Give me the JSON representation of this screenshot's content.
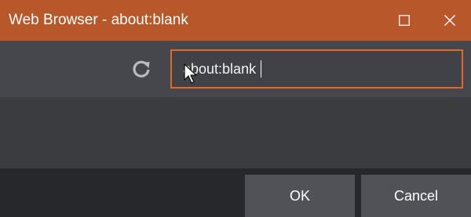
{
  "window": {
    "title": "Web Browser - about:blank",
    "accent_color": "#b8572a",
    "focus_color": "#e0692a"
  },
  "titlebar_buttons": {
    "maximize_icon": "maximize-icon",
    "close_icon": "close-icon"
  },
  "toolbar": {
    "reload_icon": "reload-icon",
    "url_value": "about:blank"
  },
  "dialog": {
    "ok_label": "OK",
    "cancel_label": "Cancel"
  }
}
